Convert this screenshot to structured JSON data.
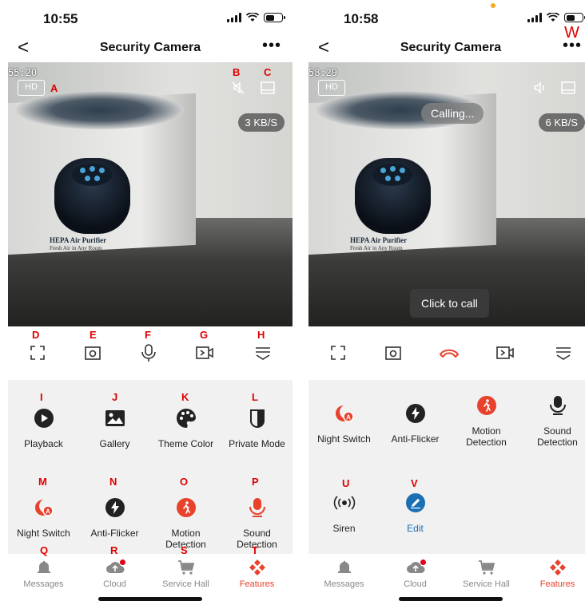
{
  "app": {
    "accent": "#e8412c",
    "header_title": "Security Camera",
    "more_label": "•••",
    "back_label": "<"
  },
  "left": {
    "time": "10:55",
    "timestamp": "55:20",
    "hd": "HD",
    "speed": "3 KB/S",
    "controls": [
      "fullscreen-icon",
      "screenshot-icon",
      "microphone-icon",
      "record-icon",
      "collapse-icon"
    ],
    "features": [
      {
        "label": "Playback",
        "icon": "play-icon"
      },
      {
        "label": "Gallery",
        "icon": "image-icon"
      },
      {
        "label": "Theme Color",
        "icon": "palette-icon"
      },
      {
        "label": "Private Mode",
        "icon": "shield-icon"
      },
      {
        "label": "Night Switch",
        "icon": "night-icon"
      },
      {
        "label": "Anti-Flicker",
        "icon": "flash-icon"
      },
      {
        "label": "Motion\nDetection",
        "icon": "walking-icon"
      },
      {
        "label": "Sound\nDetection",
        "icon": "microphone-icon"
      }
    ],
    "annotations": {
      "a": "A",
      "b": "B",
      "c": "C",
      "d": "D",
      "e": "E",
      "f": "F",
      "g": "G",
      "h": "H",
      "i": "I",
      "j": "J",
      "k": "K",
      "l": "L",
      "m": "M",
      "n": "N",
      "o": "O",
      "p": "P",
      "q": "Q",
      "r": "R",
      "s": "S",
      "t": "T"
    }
  },
  "right": {
    "time": "10:58",
    "timestamp": "58:29",
    "hd": "HD",
    "speed": "6 KB/S",
    "calling": "Calling...",
    "click_to_call": "Click to call",
    "controls": [
      "fullscreen-icon",
      "screenshot-icon",
      "hangup-icon",
      "record-icon",
      "collapse-icon"
    ],
    "features": [
      {
        "label": "Night Switch",
        "icon": "night-icon"
      },
      {
        "label": "Anti-Flicker",
        "icon": "flash-icon"
      },
      {
        "label": "Motion\nDetection",
        "icon": "walking-icon"
      },
      {
        "label": "Sound\nDetection",
        "icon": "microphone-icon"
      },
      {
        "label": "Siren",
        "icon": "siren-icon"
      },
      {
        "label": "Edit",
        "icon": "edit-icon"
      }
    ],
    "annotations": {
      "u": "U",
      "v": "V",
      "w": "W"
    }
  },
  "tabs": [
    {
      "label": "Messages",
      "icon": "bell-icon"
    },
    {
      "label": "Cloud",
      "icon": "cloud-icon"
    },
    {
      "label": "Service Hall",
      "icon": "cart-icon"
    },
    {
      "label": "Features",
      "icon": "features-icon"
    }
  ]
}
